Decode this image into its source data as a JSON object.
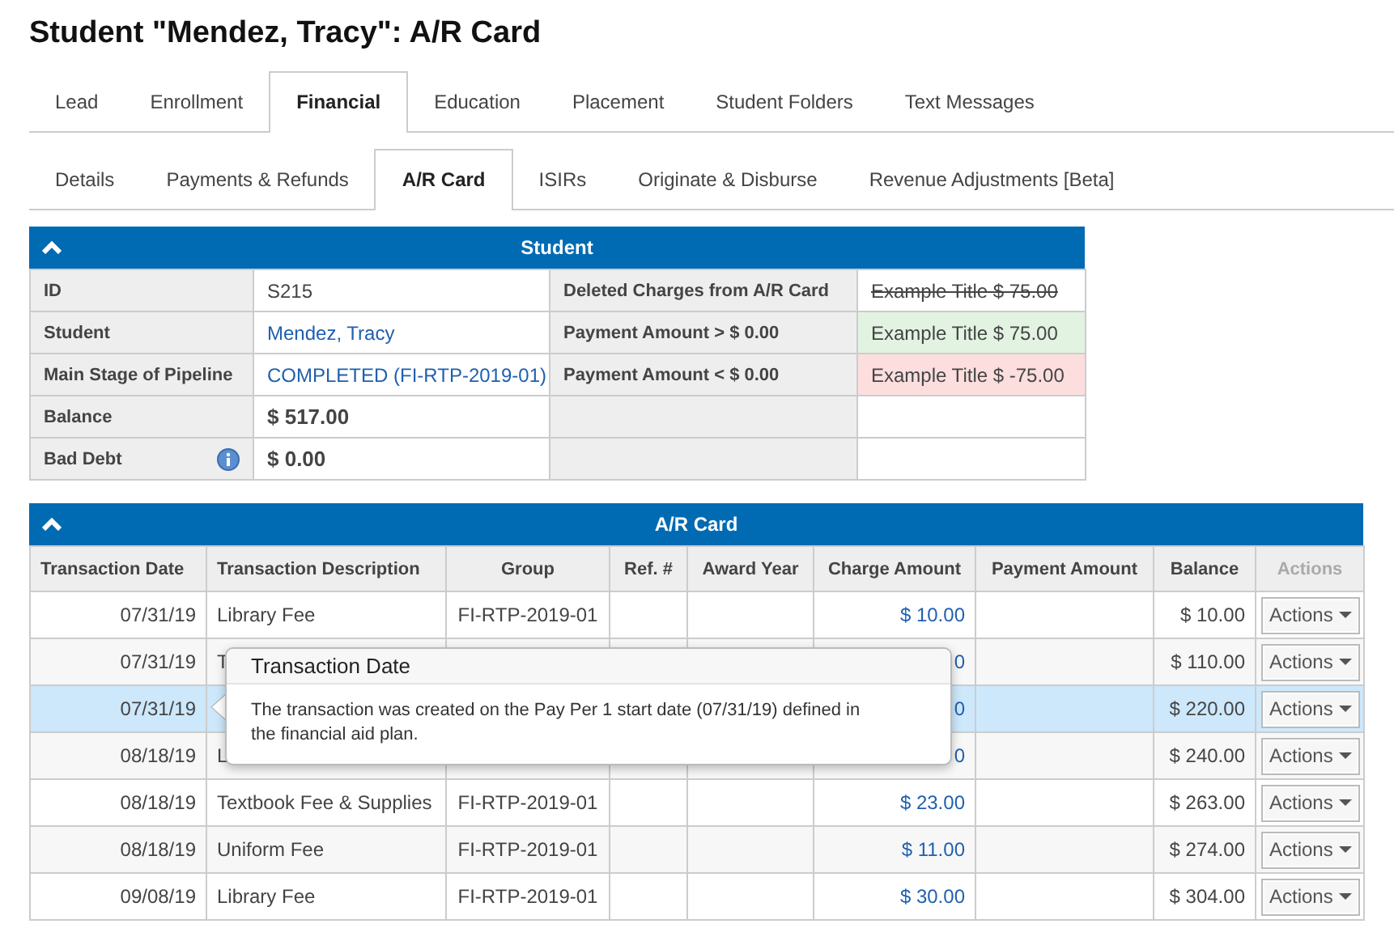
{
  "page_title": "Student \"Mendez, Tracy\": A/R Card",
  "main_tabs": [
    {
      "label": "Lead",
      "selected": false
    },
    {
      "label": "Enrollment",
      "selected": false
    },
    {
      "label": "Financial",
      "selected": true
    },
    {
      "label": "Education",
      "selected": false
    },
    {
      "label": "Placement",
      "selected": false
    },
    {
      "label": "Student Folders",
      "selected": false
    },
    {
      "label": "Text Messages",
      "selected": false
    }
  ],
  "sub_tabs": [
    {
      "label": "Details",
      "selected": false
    },
    {
      "label": "Payments & Refunds",
      "selected": false
    },
    {
      "label": "A/R Card",
      "selected": true
    },
    {
      "label": "ISIRs",
      "selected": false
    },
    {
      "label": "Originate & Disburse",
      "selected": false
    },
    {
      "label": "Revenue Adjustments [Beta]",
      "selected": false
    }
  ],
  "student_panel": {
    "title": "Student",
    "rows": [
      {
        "label": "ID",
        "value": "S215",
        "is_link": false,
        "emphasized": false,
        "has_info": false,
        "legend_label": "Deleted Charges from A/R Card",
        "legend_value": "Example Title $ 75.00",
        "struck": true
      },
      {
        "label": "Student",
        "value": "Mendez, Tracy",
        "is_link": true,
        "emphasized": false,
        "has_info": false,
        "legend_label": "Payment Amount > $ 0.00",
        "legend_value": "Example Title $ 75.00",
        "struck": false,
        "positive": true,
        "negative": false
      },
      {
        "label": "Main Stage of Pipeline",
        "value": "COMPLETED (FI-RTP-2019-01)",
        "is_link": true,
        "emphasized": false,
        "has_info": false,
        "legend_label": "Payment Amount < $ 0.00",
        "legend_value": "Example Title $ -75.00",
        "struck": false,
        "positive": false,
        "negative": true
      },
      {
        "label": "Balance",
        "value": "$ 517.00",
        "is_link": false,
        "emphasized": true,
        "has_info": false
      },
      {
        "label": "Bad Debt",
        "value": "$ 0.00",
        "is_link": false,
        "emphasized": true,
        "has_info": true
      }
    ]
  },
  "ar_card": {
    "title": "A/R Card",
    "columns": [
      {
        "label": "Transaction Date",
        "disabled": false
      },
      {
        "label": "Transaction Description",
        "disabled": false
      },
      {
        "label": "Group",
        "disabled": false
      },
      {
        "label": "Ref. #",
        "disabled": false
      },
      {
        "label": "Award Year",
        "disabled": false
      },
      {
        "label": "Charge Amount",
        "disabled": false
      },
      {
        "label": "Payment Amount",
        "disabled": false
      },
      {
        "label": "Balance",
        "disabled": false
      },
      {
        "label": "Actions",
        "disabled": true
      }
    ],
    "rows": [
      {
        "date": "07/31/19",
        "description": "Library Fee",
        "group": "FI-RTP-2019-01",
        "charge": "$ 10.00",
        "balance": "$ 10.00",
        "action": "Actions",
        "selected": false
      },
      {
        "date": "07/31/19",
        "description": "T",
        "charge": "0",
        "balance": "$ 110.00",
        "action": "Actions",
        "selected": false
      },
      {
        "date": "07/31/19",
        "charge": "0",
        "balance": "$ 220.00",
        "action": "Actions",
        "selected": true
      },
      {
        "date": "08/18/19",
        "description": "L",
        "charge": "0",
        "balance": "$ 240.00",
        "action": "Actions",
        "selected": false
      },
      {
        "date": "08/18/19",
        "description": "Textbook Fee & Supplies",
        "group": "FI-RTP-2019-01",
        "charge": "$ 23.00",
        "balance": "$ 263.00",
        "action": "Actions",
        "selected": false
      },
      {
        "date": "08/18/19",
        "description": "Uniform Fee",
        "group": "FI-RTP-2019-01",
        "charge": "$ 11.00",
        "balance": "$ 274.00",
        "action": "Actions",
        "selected": false
      },
      {
        "date": "09/08/19",
        "description": "Library Fee",
        "group": "FI-RTP-2019-01",
        "charge": "$ 30.00",
        "balance": "$ 304.00",
        "action": "Actions",
        "selected": false
      }
    ],
    "tooltip": {
      "title": "Transaction Date",
      "text": "The transaction was created on the Pay Per 1 start date (07/31/19) defined in the financial aid plan."
    }
  }
}
